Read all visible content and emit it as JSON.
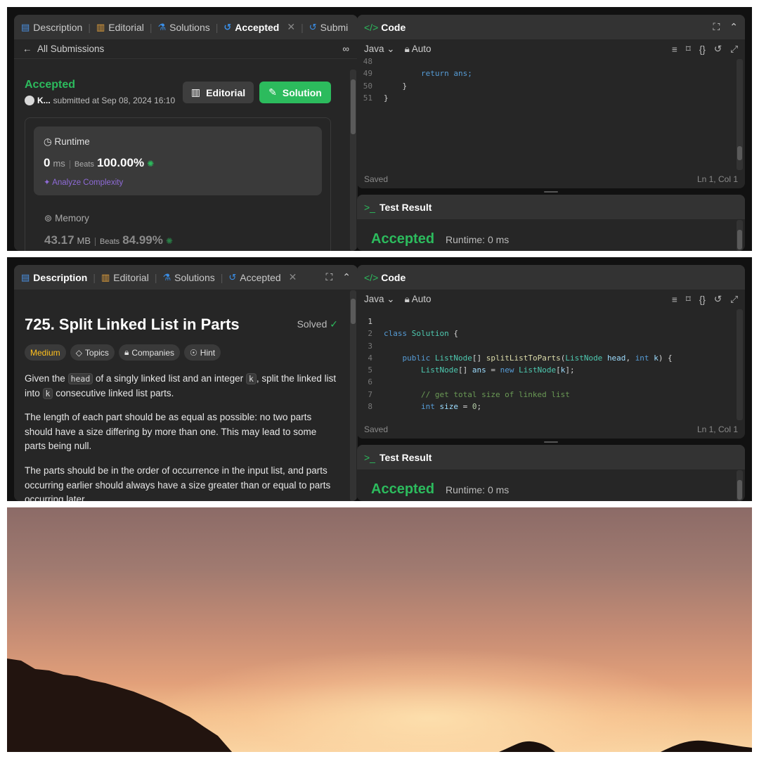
{
  "tabs": {
    "description": "Description",
    "editorial": "Editorial",
    "solutions": "Solutions",
    "accepted": "Accepted",
    "submissions_cut": "Submi"
  },
  "submission": {
    "back_label": "All Submissions",
    "status": "Accepted",
    "user": "K...",
    "submitted_at": "submitted at Sep 08, 2024 16:10",
    "editorial_btn": "Editorial",
    "solution_btn": "Solution",
    "runtime_label": "Runtime",
    "runtime_value": "0",
    "runtime_unit": "ms",
    "beats_label": "Beats",
    "runtime_beats": "100.00%",
    "analyze": "Analyze Complexity",
    "memory_label": "Memory",
    "memory_value": "43.17",
    "memory_unit": "MB",
    "memory_beats": "84.99%"
  },
  "problem": {
    "title": "725. Split Linked List in Parts",
    "solved": "Solved",
    "difficulty": "Medium",
    "topics": "Topics",
    "companies": "Companies",
    "hint": "Hint",
    "p1_a": "Given the",
    "p1_code1": "head",
    "p1_b": "of a singly linked list and an integer",
    "p1_code2": "k",
    "p1_c": ", split the linked list into",
    "p1_code3": "k",
    "p1_d": "consecutive linked list parts.",
    "p2": "The length of each part should be as equal as possible: no two parts should have a size differing by more than one. This may lead to some parts being null.",
    "p3": "The parts should be in the order of occurrence in the input list, and parts occurring earlier should always have a size greater than or equal to parts occurring later."
  },
  "editor": {
    "title": "Code",
    "language": "Java",
    "mode": "Auto",
    "saved": "Saved",
    "cursor": "Ln 1, Col 1",
    "top_lines": [
      {
        "n": "48",
        "t": ""
      },
      {
        "n": "49",
        "t": "        return ans;"
      },
      {
        "n": "50",
        "t": "    }"
      },
      {
        "n": "51",
        "t": "}"
      }
    ],
    "bottom_lines": [
      {
        "n": "1",
        "t": ""
      },
      {
        "n": "2",
        "t": "class Solution {"
      },
      {
        "n": "3",
        "t": ""
      },
      {
        "n": "4",
        "t": "    public ListNode[] splitListToParts(ListNode head, int k) {"
      },
      {
        "n": "5",
        "t": "        ListNode[] ans = new ListNode[k];"
      },
      {
        "n": "6",
        "t": ""
      },
      {
        "n": "7",
        "t": "        // get total size of linked list"
      },
      {
        "n": "8",
        "t": "        int size = 0;"
      }
    ]
  },
  "test_result": {
    "title": "Test Result",
    "status": "Accepted",
    "runtime": "Runtime: 0 ms"
  },
  "colors": {
    "accent_green": "#2cbb5d",
    "medium": "#ffc01e",
    "bg": "#262626"
  }
}
